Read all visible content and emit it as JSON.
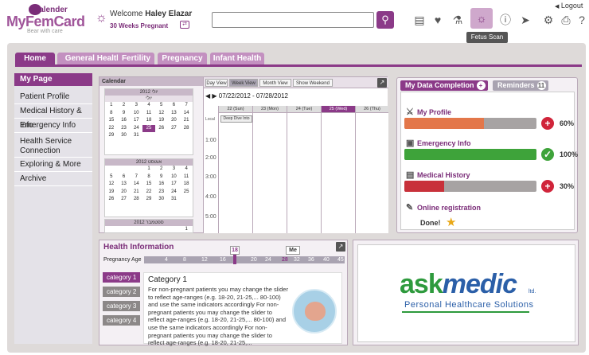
{
  "app": {
    "logo_main": "MyFemCard",
    "logo_sub": "Calender",
    "tagline": "Bear with care"
  },
  "user": {
    "welcome": "Welcome",
    "name": "Haley Elazar",
    "weeks": "30 Weeks Pregnant"
  },
  "search": {
    "placeholder": ""
  },
  "toolbar": {
    "tooltip": "Fetus Scan",
    "logout": "Logout",
    "icons": [
      "document-icon",
      "heart-icon",
      "flask-icon",
      "ultrasound-icon",
      "alert-icon",
      "pill-icon",
      "gear-icon",
      "print-icon",
      "help-icon"
    ]
  },
  "tabs": [
    "Home",
    "General Health",
    "Fertility",
    "Pregnancy",
    "Infant Health"
  ],
  "sidebar": {
    "header": "My Page",
    "items": [
      "Patient Profile",
      "Medical History & Info",
      "Emergency Info",
      "Health Service Connection",
      "Exploring & More",
      "Archive"
    ]
  },
  "calendar": {
    "title": "Calendar",
    "months": [
      {
        "name": "יולי",
        "header": "2012 יולי",
        "days": [
          "1",
          "2",
          "3",
          "4",
          "5",
          "6",
          "7",
          "8",
          "9",
          "10",
          "11",
          "12",
          "13",
          "14",
          "15",
          "16",
          "17",
          "18",
          "19",
          "20",
          "21",
          "22",
          "23",
          "24",
          "25",
          "26",
          "27",
          "28",
          "29",
          "30",
          "31",
          "",
          "",
          "",
          ""
        ]
      },
      {
        "name": "אוגוסט",
        "header": "2012 אוגוסט",
        "days": [
          "",
          "",
          "",
          "1",
          "2",
          "3",
          "4",
          "5",
          "6",
          "7",
          "8",
          "9",
          "10",
          "11",
          "12",
          "13",
          "14",
          "15",
          "16",
          "17",
          "18",
          "19",
          "20",
          "21",
          "22",
          "23",
          "24",
          "25",
          "26",
          "27",
          "28",
          "29",
          "30",
          "31",
          ""
        ]
      },
      {
        "name": "ספטמבר",
        "header": "2012 ספטמבר",
        "days": [
          "",
          "",
          "",
          "",
          "",
          "",
          "1",
          "2",
          "3",
          "4",
          "5",
          "6",
          "7",
          "8"
        ]
      }
    ],
    "selected_day": "25",
    "views": [
      "Day View",
      "Week View",
      "Month View",
      "Show Weekend"
    ],
    "active_view": "Week View",
    "date_range": "07/22/2012 - 07/28/2012",
    "day_headers": [
      "22 (Sun)",
      "23 (Mon)",
      "24 (Tue)",
      "25 (Wed)",
      "26 (Thu)"
    ],
    "hours": [
      "Local",
      "1:00",
      "2:00",
      "3:00",
      "4:00",
      "5:00",
      "6:00"
    ],
    "event": "Deep Dive Into"
  },
  "completion": {
    "tab": "My Data Completion",
    "reminders_tab": "Reminders",
    "reminders_count": "11",
    "items": [
      {
        "label": "My Profile",
        "percent": 60,
        "percent_text": "60%",
        "color": "#e3774a",
        "status": "plus"
      },
      {
        "label": "Emergency Info",
        "percent": 100,
        "percent_text": "100%",
        "color": "#3ea33a",
        "status": "check"
      },
      {
        "label": "Medical History",
        "percent": 30,
        "percent_text": "30%",
        "color": "#c8313a",
        "status": "plus"
      }
    ],
    "online_label": "Online registration",
    "done_text": "Done!"
  },
  "health_info": {
    "title": "Health Information",
    "age_label": "Pregnancy Age",
    "ticks": [
      "4",
      "8",
      "12",
      "16",
      "20",
      "24",
      "28",
      "32",
      "36",
      "40",
      "45"
    ],
    "current_marker": "18",
    "me_marker": "Me",
    "categories": [
      "category 1",
      "category 2",
      "category 3",
      "category 4"
    ],
    "active_category": "Category 1",
    "text": "For non-pregnant patients you may change the slider to reflect age-ranges (e.g. 18-20, 21-25,... 80-100) and use the same indicators accordingly For non-pregnant patients you may change the slider to reflect age-ranges (e.g. 18-20, 21-25,... 80-100) and use the same indicators accordingly For non-pregnant patients you may change the slider to reflect age-ranges (e.g. 18-20, 21-25,..."
  },
  "ad": {
    "brand_a": "ask",
    "brand_b": "medic",
    "ltd": "ltd.",
    "subtitle": "Personal Healthcare Solutions"
  }
}
